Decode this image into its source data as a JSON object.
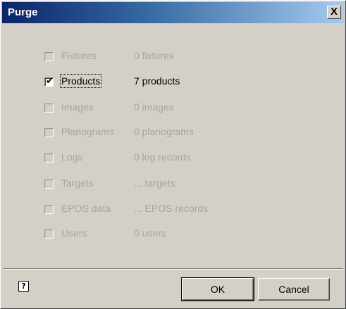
{
  "window": {
    "title": "Purge",
    "close_label": "X"
  },
  "items": [
    {
      "label": "Fixtures",
      "value": "0 fixtures",
      "checked": false,
      "enabled": false
    },
    {
      "label": "Products",
      "value": "7 products",
      "checked": true,
      "enabled": true
    },
    {
      "label": "Images",
      "value": "0 images",
      "checked": false,
      "enabled": false
    },
    {
      "label": "Planograms",
      "value": "0 planograms",
      "checked": false,
      "enabled": false
    },
    {
      "label": "Logs",
      "value": "0 log records",
      "checked": false,
      "enabled": false
    },
    {
      "label": "Targets",
      "value": "... targets",
      "checked": false,
      "enabled": false
    },
    {
      "label": "EPOS data",
      "value": "... EPOS records",
      "checked": false,
      "enabled": false
    },
    {
      "label": "Users",
      "value": "0 users",
      "checked": false,
      "enabled": false
    }
  ],
  "footer": {
    "help_label": "?",
    "ok_label": "OK",
    "cancel_label": "Cancel"
  },
  "colors": {
    "face": "#d4d0c8",
    "title_start": "#0a246a",
    "title_end": "#a6caf0",
    "disabled_text": "#a8a59e"
  }
}
